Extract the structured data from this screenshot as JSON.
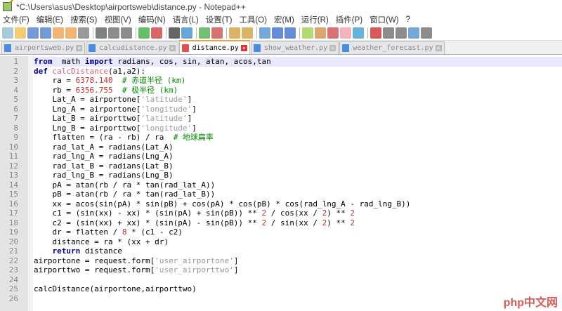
{
  "window": {
    "title": "*C:\\Users\\asus\\Desktop\\airportsweb\\distance.py - Notepad++"
  },
  "menu": [
    "文件(F)",
    "编辑(E)",
    "搜索(S)",
    "视图(V)",
    "编码(N)",
    "语言(L)",
    "设置(T)",
    "工具(O)",
    "宏(M)",
    "运行(R)",
    "插件(P)",
    "窗口(W)",
    "?"
  ],
  "tabs": [
    {
      "label": "airportsweb.py",
      "active": false
    },
    {
      "label": "calcudistance.py",
      "active": false
    },
    {
      "label": "distance.py",
      "active": true
    },
    {
      "label": "show_weather.py",
      "active": false
    },
    {
      "label": "weather_forecast.py",
      "active": false
    }
  ],
  "watermark": "php中文网",
  "code": [
    [
      [
        "kw",
        "from"
      ],
      [
        "",
        "  math "
      ],
      [
        "kw",
        "import"
      ],
      [
        "",
        " radians, cos, sin, atan, acos,tan"
      ]
    ],
    [
      [
        "kw",
        "def"
      ],
      [
        "",
        " "
      ],
      [
        "fn",
        "calcDistance"
      ],
      [
        "",
        "(a1,a2):"
      ]
    ],
    [
      [
        "",
        "    ra = "
      ],
      [
        "num",
        "6378.140"
      ],
      [
        "",
        "  "
      ],
      [
        "cmt",
        "# 赤道半径 (km)"
      ]
    ],
    [
      [
        "",
        "    rb = "
      ],
      [
        "num",
        "6356.755"
      ],
      [
        "",
        "  "
      ],
      [
        "cmt",
        "# 极半径 (km)"
      ]
    ],
    [
      [
        "",
        "    Lat_A = airportone["
      ],
      [
        "str",
        "'latitude'"
      ],
      [
        "",
        "]"
      ]
    ],
    [
      [
        "",
        "    Lng_A = airportone["
      ],
      [
        "str",
        "'longitude'"
      ],
      [
        "",
        "]"
      ]
    ],
    [
      [
        "",
        "    Lat_B = airporttwo["
      ],
      [
        "str",
        "'latitude'"
      ],
      [
        "",
        "]"
      ]
    ],
    [
      [
        "",
        "    Lng_B = airporttwo["
      ],
      [
        "str",
        "'longitude'"
      ],
      [
        "",
        "]"
      ]
    ],
    [
      [
        "",
        "    flatten = (ra - rb) / ra  "
      ],
      [
        "cmt",
        "# 地球扁率"
      ]
    ],
    [
      [
        "",
        "    rad_lat_A = radians(Lat_A)"
      ]
    ],
    [
      [
        "",
        "    rad_lng_A = radians(Lng_A)"
      ]
    ],
    [
      [
        "",
        "    rad_lat_B = radians(Lat_B)"
      ]
    ],
    [
      [
        "",
        "    rad_lng_B = radians(Lng_B)"
      ]
    ],
    [
      [
        "",
        "    pA = atan(rb / ra * tan(rad_lat_A))"
      ]
    ],
    [
      [
        "",
        "    pB = atan(rb / ra * tan(rad_lat_B))"
      ]
    ],
    [
      [
        "",
        "    xx = acos(sin(pA) * sin(pB) + cos(pA) * cos(pB) * cos(rad_lng_A - rad_lng_B))"
      ]
    ],
    [
      [
        "",
        "    c1 = (sin(xx) - xx) * (sin(pA) + sin(pB)) ** "
      ],
      [
        "num",
        "2"
      ],
      [
        "",
        " / cos(xx / "
      ],
      [
        "num",
        "2"
      ],
      [
        "",
        ") ** "
      ],
      [
        "num",
        "2"
      ]
    ],
    [
      [
        "",
        "    c2 = (sin(xx) + xx) * (sin(pA) - sin(pB)) ** "
      ],
      [
        "num",
        "2"
      ],
      [
        "",
        " / sin(xx / "
      ],
      [
        "num",
        "2"
      ],
      [
        "",
        ") ** "
      ],
      [
        "num",
        "2"
      ]
    ],
    [
      [
        "",
        "    dr = flatten / "
      ],
      [
        "num",
        "8"
      ],
      [
        "",
        " * (c1 - c2)"
      ]
    ],
    [
      [
        "",
        "    distance = ra * (xx + dr)"
      ]
    ],
    [
      [
        "",
        "    "
      ],
      [
        "kw",
        "return"
      ],
      [
        "",
        " distance"
      ]
    ],
    [
      [
        "",
        "airportone = request.form["
      ],
      [
        "str",
        "'user_airportone'"
      ],
      [
        "",
        "]"
      ]
    ],
    [
      [
        "",
        "airporttwo = request.form["
      ],
      [
        "str",
        "'user_airporttwo'"
      ],
      [
        "",
        "]"
      ]
    ],
    [
      [
        "",
        ""
      ]
    ],
    [
      [
        "",
        "calcDistance(airportone,airporttwo)"
      ]
    ],
    [
      [
        "",
        ""
      ]
    ]
  ]
}
